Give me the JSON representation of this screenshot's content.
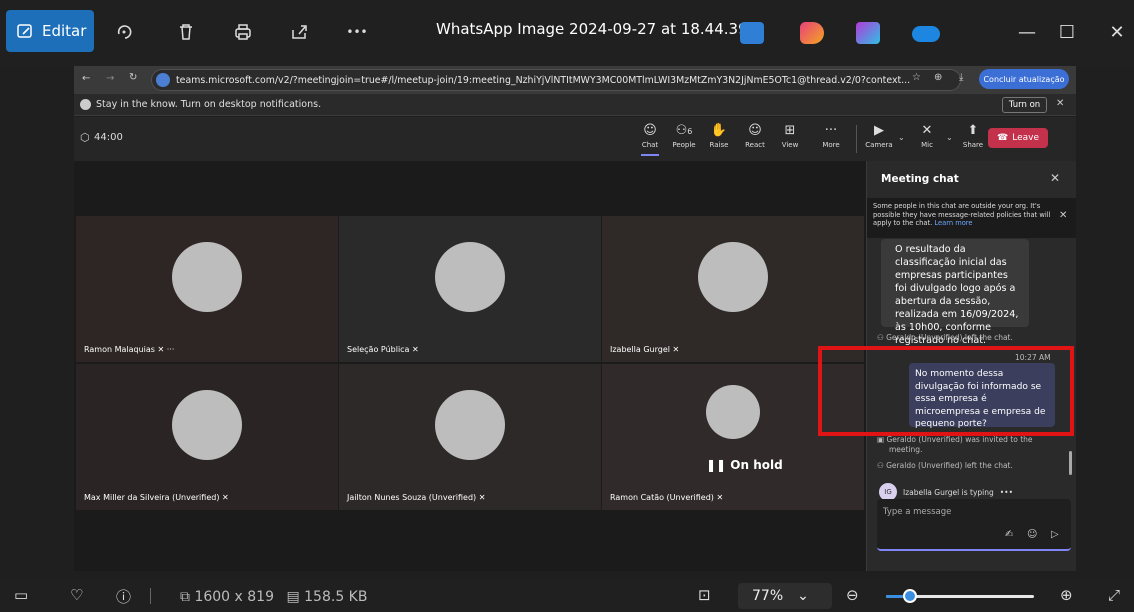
{
  "viewer": {
    "edit_label": "Editar",
    "title": "WhatsApp Image 2024-09-27 at 18.44.39...",
    "icons": [
      "edit-icon",
      "rotate-icon",
      "trash-icon",
      "print-icon",
      "share-icon",
      "more-icon"
    ],
    "more_glyph": "•••"
  },
  "browser": {
    "url": "teams.microsoft.com/v2/?meetingjoin=true#/l/meetup-join/19:meeting_NzhiYjVlNTItMWY3MC00MTlmLWI3MzMtZmY3N2JjNmE5OTc1@thread.v2/0?context...",
    "update_label": "Concluir atualização",
    "notification": "Stay in the know. Turn on desktop notifications.",
    "turn_on_label": "Turn on"
  },
  "teams": {
    "timer": "44:00",
    "toolbar": [
      {
        "label": "Chat",
        "icon": "chat-icon",
        "glyph": "☺"
      },
      {
        "label": "People",
        "icon": "people-icon",
        "glyph": "⚇",
        "badge": "6"
      },
      {
        "label": "Raise",
        "icon": "raise-hand-icon",
        "glyph": "✋"
      },
      {
        "label": "React",
        "icon": "react-icon",
        "glyph": "☺"
      },
      {
        "label": "View",
        "icon": "view-icon",
        "glyph": "⊞"
      },
      {
        "label": "More",
        "icon": "more-icon",
        "glyph": "···"
      },
      {
        "label": "Camera",
        "icon": "camera-off-icon",
        "glyph": "▶"
      },
      {
        "label": "Mic",
        "icon": "mic-off-icon",
        "glyph": "✕"
      },
      {
        "label": "Share",
        "icon": "share-screen-icon",
        "glyph": "⬆"
      }
    ],
    "leave_label": "Leave"
  },
  "participants": [
    {
      "name": "Ramon Malaquias"
    },
    {
      "name": "Seleção Pública"
    },
    {
      "name": "Izabella Gurgel"
    },
    {
      "name": "Max Miller da Silveira (Unverified)"
    },
    {
      "name": "Jailton Nunes Souza (Unverified)"
    },
    {
      "name": "Ramon Catão (Unverified)",
      "status": "On hold"
    }
  ],
  "chat": {
    "title": "Meeting chat",
    "warning": "Some people in this chat are outside your org. It's possible they have message-related policies that will apply to the chat.",
    "learn_more": "Learn more",
    "message1": "O resultado da classificação inicial das empresas participantes foi divulgado logo após a abertura da sessão, realizada em 16/09/2024, às 10h00, conforme registrado no chat.",
    "system1": "Geraldo (Unverified) left the chat.",
    "time": "10:27 AM",
    "message2": "No momento dessa divulgação foi informado se essa empresa é microempresa e empresa de pequeno porte?",
    "system2a": "Geraldo (Unverified) was invited to the",
    "system2b": "meeting.",
    "system3": "Geraldo (Unverified) left the chat.",
    "typing_initials": "IG",
    "typing": "Izabella Gurgel is typing",
    "placeholder": "Type a message"
  },
  "statusbar": {
    "dimensions": "1600 x 819",
    "filesize": "158.5 KB",
    "zoom": "77%",
    "zoom_level": 0.16
  }
}
